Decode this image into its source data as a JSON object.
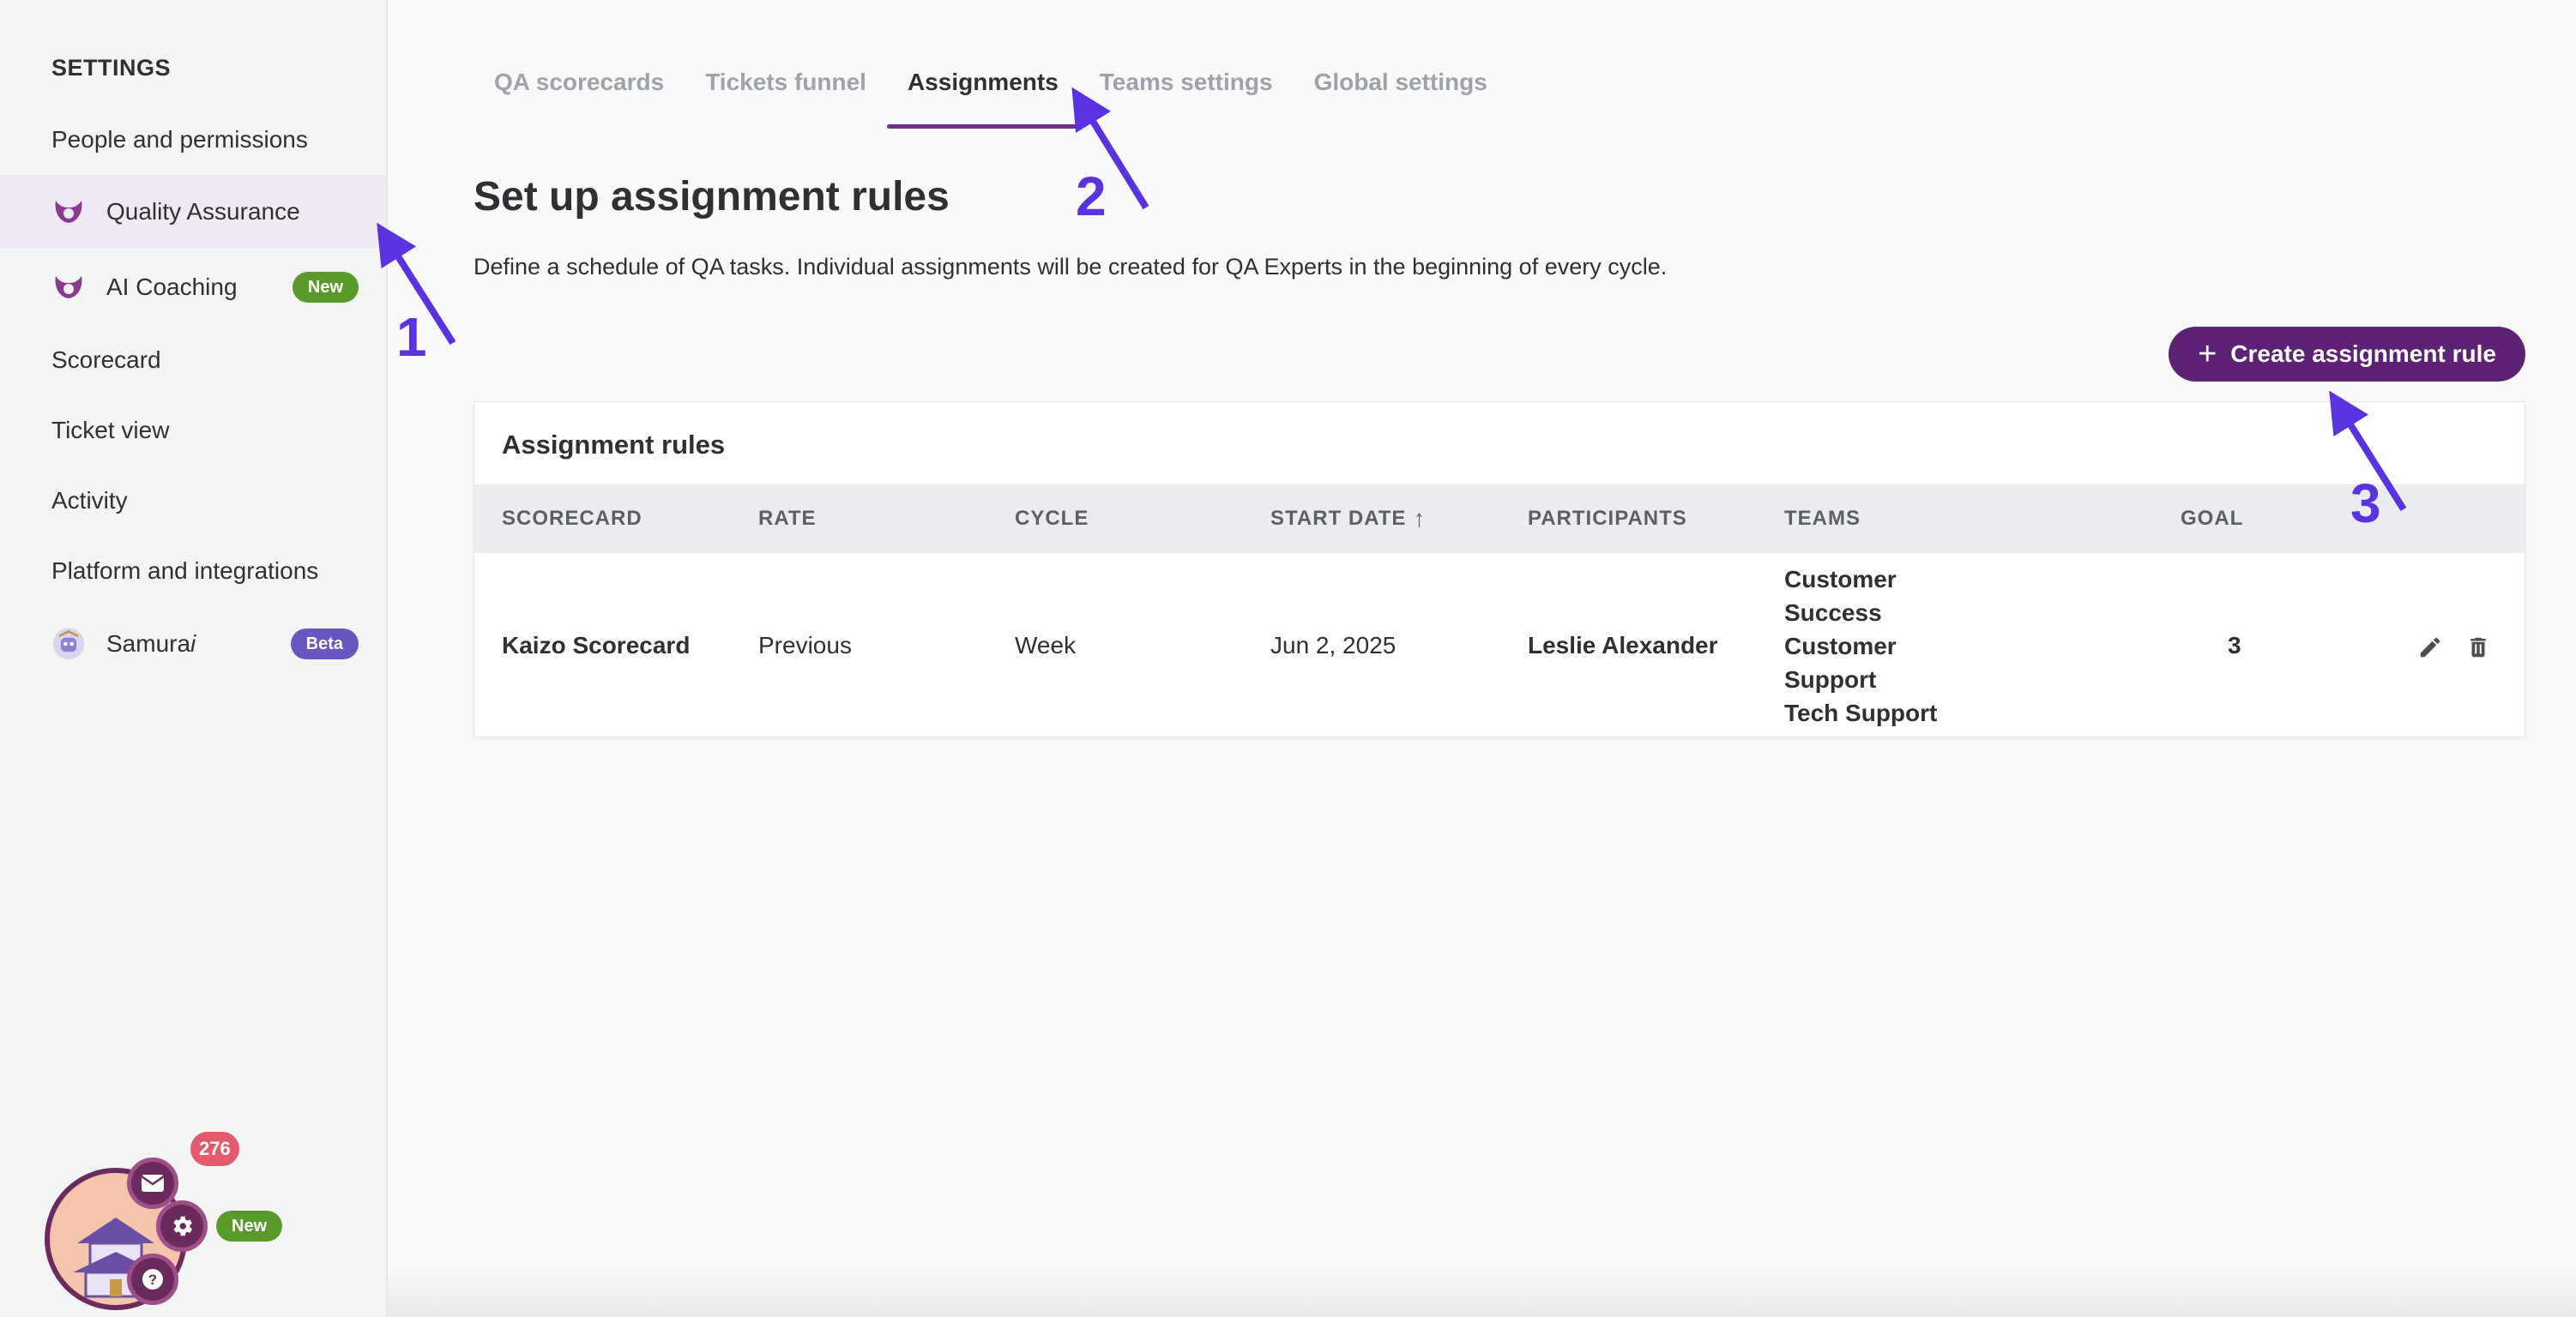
{
  "sidebar": {
    "heading": "SETTINGS",
    "items": [
      {
        "label": "People and permissions"
      },
      {
        "label": "Quality Assurance",
        "active": true,
        "icon": "qa-icon"
      },
      {
        "label": "AI Coaching",
        "icon": "qa-icon",
        "badge": "New"
      },
      {
        "label": "Scorecard"
      },
      {
        "label": "Ticket view"
      },
      {
        "label": "Activity"
      },
      {
        "label": "Platform and integrations"
      },
      {
        "label_main": "Samura",
        "label_italic": "i",
        "icon": "samurai-avatar-icon",
        "badge": "Beta"
      }
    ]
  },
  "tabs": [
    {
      "label": "QA scorecards"
    },
    {
      "label": "Tickets funnel"
    },
    {
      "label": "Assignments",
      "active": true
    },
    {
      "label": "Teams settings"
    },
    {
      "label": "Global settings"
    }
  ],
  "page": {
    "title": "Set up assignment rules",
    "description": "Define a schedule of QA tasks. Individual assignments will be created for QA Experts in the beginning of every cycle.",
    "create_button": "Create assignment rule"
  },
  "table": {
    "title": "Assignment rules",
    "columns": [
      "SCORECARD",
      "RATE",
      "CYCLE",
      "START DATE",
      "PARTICIPANTS",
      "TEAMS",
      "GOAL"
    ],
    "sort_indicator": "↑",
    "rows": [
      {
        "scorecard": "Kaizo Scorecard",
        "rate": "Previous",
        "cycle": "Week",
        "start_date": "Jun 2, 2025",
        "participants": "Leslie Alexander",
        "teams": [
          "Customer",
          "Success",
          "Customer",
          "Support",
          "Tech Support"
        ],
        "goal": "3"
      }
    ]
  },
  "annotations": [
    "1",
    "2",
    "3"
  ],
  "widget": {
    "notification_count": "276",
    "new_badge": "New"
  },
  "colors": {
    "accent": "#5d2273",
    "annotation": "#5a32e0",
    "badge_green": "#5a9a2b",
    "badge_purple": "#6a56c0"
  }
}
